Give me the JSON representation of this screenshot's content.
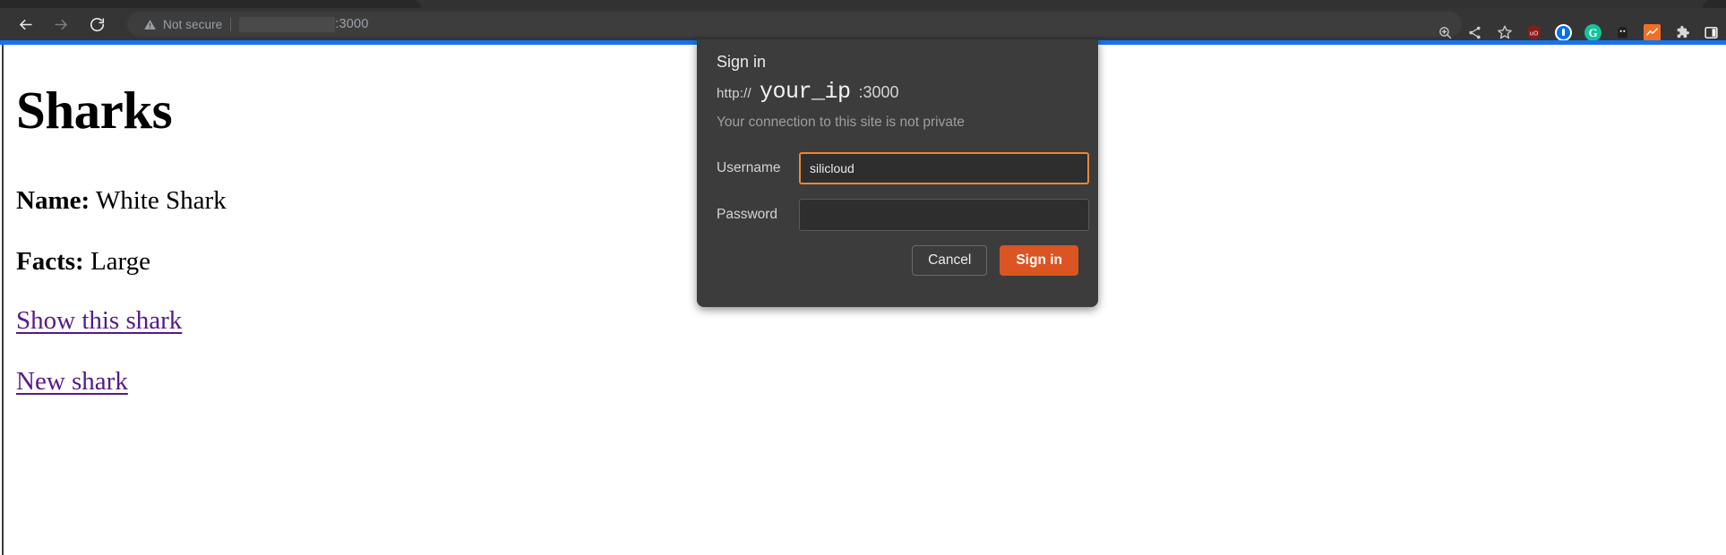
{
  "browser": {
    "nav": {
      "back_icon": "arrow-left-icon",
      "forward_icon": "arrow-right-icon",
      "reload_icon": "reload-icon"
    },
    "omnibox": {
      "security_icon": "warning-triangle-icon",
      "security_label": "Not secure",
      "url_host_redacted": "",
      "url_port": ":3000"
    },
    "toolbar_icons": [
      {
        "name": "zoom-icon",
        "label": "Zoom"
      },
      {
        "name": "share-icon",
        "label": "Share this page"
      },
      {
        "name": "bookmark-star-icon",
        "label": "Bookmark this tab"
      },
      {
        "name": "ublock-origin-extension-icon",
        "label": "uBlock Origin"
      },
      {
        "name": "1password-extension-icon",
        "label": "1Password"
      },
      {
        "name": "grammarly-extension-icon",
        "label": "Grammarly"
      },
      {
        "name": "ghostery-extension-icon",
        "label": "Ghostery"
      },
      {
        "name": "analytics-extension-icon",
        "label": "Analytics"
      },
      {
        "name": "extensions-puzzle-icon",
        "label": "Extensions"
      },
      {
        "name": "side-panel-icon",
        "label": "Side panel"
      }
    ]
  },
  "page": {
    "title": "Sharks",
    "fields": [
      {
        "label": "Name:",
        "value": "White Shark"
      },
      {
        "label": "Facts:",
        "value": "Large"
      }
    ],
    "links": [
      {
        "label": "Show this shark"
      },
      {
        "label": "New shark"
      }
    ],
    "loading_bar_color": "#1a73e8"
  },
  "dialog": {
    "title": "Sign in",
    "url_scheme": "http://",
    "url_host": "your_ip",
    "url_port": ":3000",
    "subtitle": "Your connection to this site is not private",
    "username": {
      "label": "Username",
      "value": "silicloud",
      "placeholder": ""
    },
    "password": {
      "label": "Password",
      "value": "",
      "placeholder": ""
    },
    "cancel_label": "Cancel",
    "signin_label": "Sign in",
    "accent_color": "#db5522",
    "focus_border_color": "#e8873c"
  }
}
